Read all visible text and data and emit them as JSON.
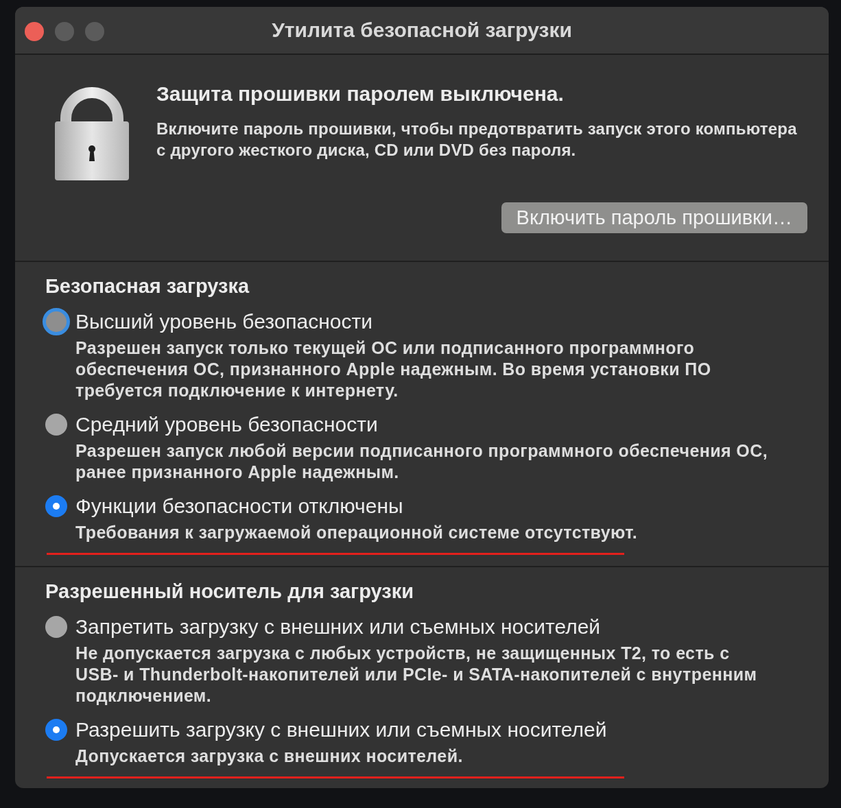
{
  "window": {
    "title": "Утилита безопасной загрузки",
    "controls": [
      {
        "kind": "close",
        "disabled": false
      },
      {
        "kind": "minimize",
        "disabled": true
      },
      {
        "kind": "zoom",
        "disabled": true
      }
    ]
  },
  "firmware_password": {
    "heading": "Защита прошивки паролем выключена.",
    "description": "Включите пароль прошивки, чтобы предотвратить запуск этого компьютера с другого жесткого диска, CD или DVD без пароля.",
    "button": "Включить пароль прошивки…"
  },
  "sections": [
    {
      "title": "Безопасная загрузка",
      "options": [
        {
          "label": "Высший уровень безопасности",
          "description": "Разрешен запуск только текущей ОС или подписанного программного обеспечения ОС, признанного Apple надежным. Во время установки ПО требуется подключение к интернету.",
          "selected": false,
          "focused": true,
          "annotated": false
        },
        {
          "label": "Средний уровень безопасности",
          "description": "Разрешен запуск любой версии подписанного программного обеспечения ОС, ранее признанного Apple надежным.",
          "selected": false,
          "focused": false,
          "annotated": false
        },
        {
          "label": "Функции безопасности отключены",
          "description": "Требования к загружаемой операционной системе отсутствуют.",
          "selected": true,
          "focused": false,
          "annotated": true
        }
      ]
    },
    {
      "title": "Разрешенный носитель для загрузки",
      "options": [
        {
          "label": "Запретить загрузку с внешних или съемных носителей",
          "description": "Не допускается загрузка с любых устройств, не защищенных T2, то есть с USB- и Thunderbolt-накопителей или PCIe- и SATA-накопителей с внутренним подключением.",
          "selected": false,
          "focused": false,
          "annotated": false
        },
        {
          "label": "Разрешить загрузку с внешних или съемных носителей",
          "description": "Допускается загрузка с внешних носителей.",
          "selected": true,
          "focused": false,
          "annotated": true
        }
      ]
    }
  ]
}
